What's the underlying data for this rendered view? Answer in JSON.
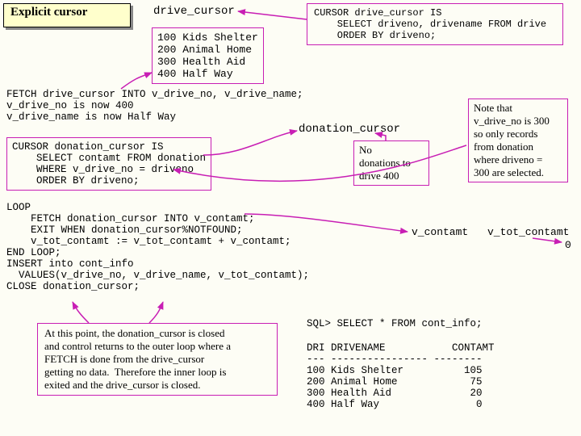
{
  "title": "Explicit cursor",
  "drive_cursor": {
    "heading": "drive_cursor",
    "rows": "100 Kids Shelter\n200 Animal Home\n300 Health Aid\n400 Half Way"
  },
  "drive_cursor_def": "CURSOR drive_cursor IS\n    SELECT driveno, drivename FROM drive\n    ORDER BY driveno;",
  "fetch_text": "FETCH drive_cursor INTO v_drive_no, v_drive_name;\nv_drive_no is now 400\nv_drive_name is now Half Way",
  "donation_cursor_heading": "donation_cursor",
  "no_donations": "No\ndonations to\ndrive 400",
  "note": "Note that\nv_drive_no is 300\nso only records\nfrom donation\nwhere driveno =\n300 are selected.",
  "donation_cursor_def": "CURSOR donation_cursor IS\n    SELECT contamt FROM donation\n    WHERE v_drive_no = driveno\n    ORDER BY driveno;",
  "loop_code": "LOOP\n    FETCH donation_cursor INTO v_contamt;\n    EXIT WHEN donation_cursor%NOTFOUND;\n    v_tot_contamt := v_tot_contamt + v_contamt;\nEND LOOP;\nINSERT into cont_info\n  VALUES(v_drive_no, v_drive_name, v_tot_contamt);\nCLOSE donation_cursor;",
  "vars": {
    "c1": "v_contamt",
    "c2": "v_tot_contamt",
    "v2": "0"
  },
  "closing_note": "At this point, the donation_cursor is closed\nand control returns to the outer loop where a\nFETCH is done from the drive_cursor\ngetting no data.  Therefore the inner loop is\nexited and the drive_cursor is closed.",
  "sql_query": "SQL> SELECT * FROM cont_info;",
  "sql_result": "DRI DRIVENAME           CONTAMT\n--- ---------------- --------\n100 Kids Shelter          105\n200 Animal Home            75\n300 Health Aid             20\n400 Half Way                0"
}
